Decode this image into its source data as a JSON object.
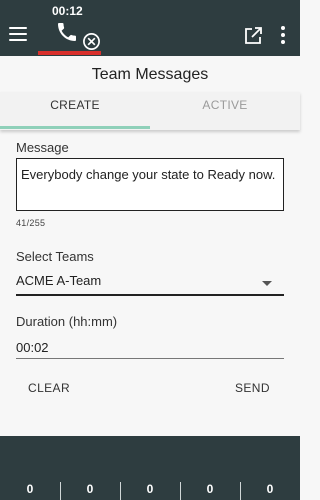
{
  "topbar": {
    "call_timer": "00:12",
    "icons": [
      "menu-icon",
      "phone-icon",
      "hangup-icon",
      "popout-icon",
      "more-vert-icon"
    ],
    "accent_color": "#d9302c",
    "background": "#2e3d40"
  },
  "card": {
    "title": "Team Messages",
    "tabs": [
      {
        "label": "CREATE",
        "selected": true
      },
      {
        "label": "ACTIVE",
        "selected": false
      }
    ],
    "tab_indicator_color": "#8fd0b9"
  },
  "form": {
    "message_label": "Message",
    "message_value": "Everybody change your state to Ready now.",
    "char_count": "41/255",
    "teams_label": "Select Teams",
    "teams_value": "ACME A-Team",
    "duration_label": "Duration (hh:mm)",
    "duration_value": "00:02",
    "clear_label": "CLEAR",
    "send_label": "SEND"
  },
  "stats": {
    "values": [
      "0",
      "0",
      "0",
      "0",
      "0"
    ]
  }
}
